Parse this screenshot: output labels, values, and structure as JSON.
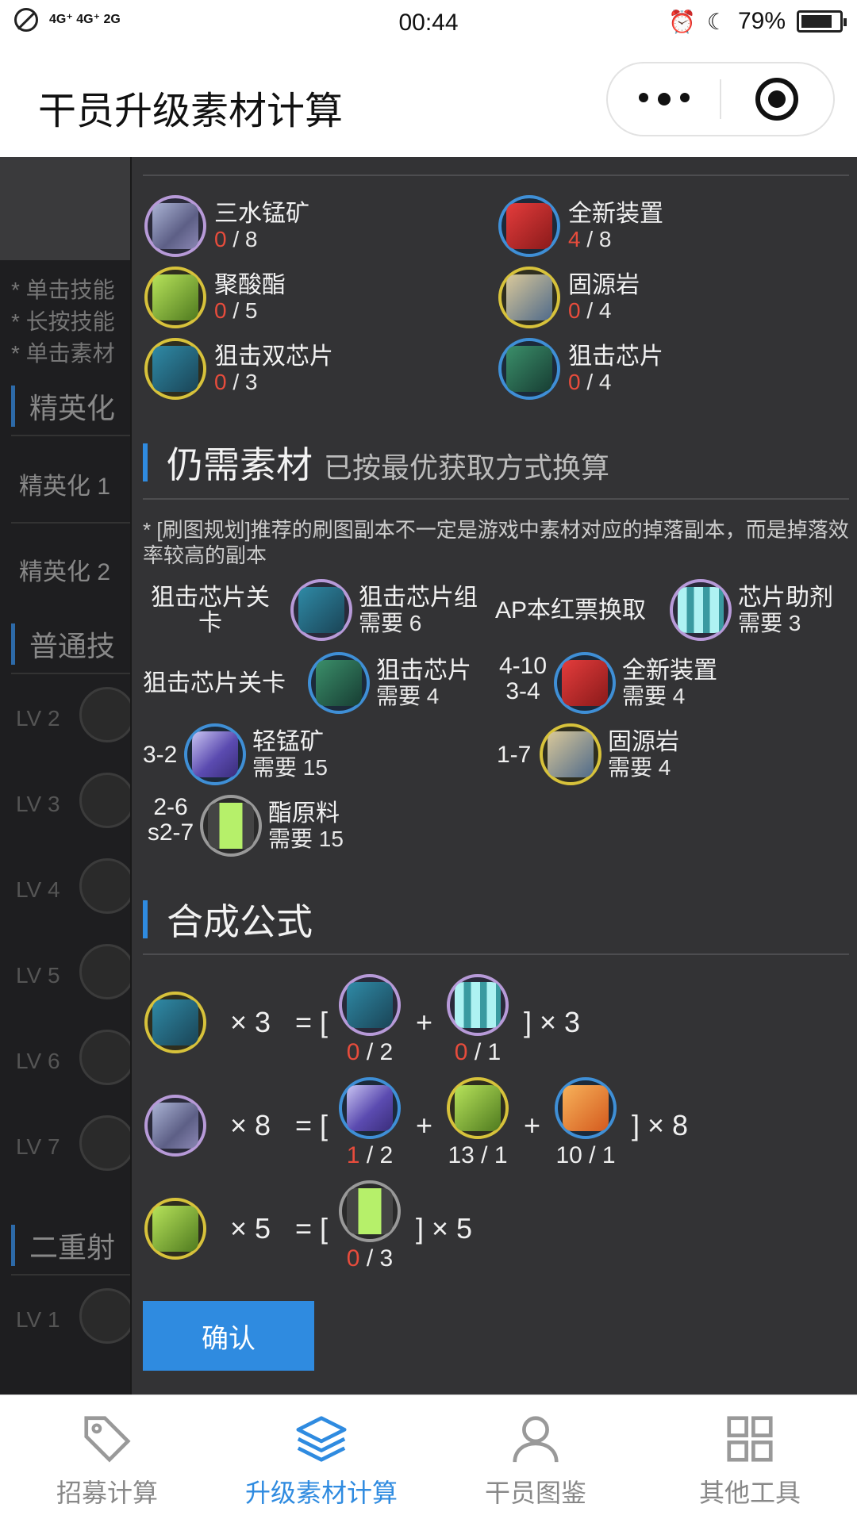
{
  "status": {
    "network": "4G⁺ 4G⁺ 2G",
    "time": "00:44",
    "battery": "79%"
  },
  "titlebar": {
    "title": "干员升级素材计算"
  },
  "background": {
    "tips": [
      "* 单击技能",
      "* 长按技能",
      "* 单击素材"
    ],
    "elite_heading": "精英化",
    "elite_items": [
      "精英化 1",
      "精英化 2"
    ],
    "skill_heading": "普通技",
    "skill_levels": [
      "LV 2",
      "LV 3",
      "LV 4",
      "LV 5",
      "LV 6",
      "LV 7"
    ],
    "second_heading": "二重射",
    "second_levels": [
      "LV 1"
    ]
  },
  "owned": [
    {
      "name": "三水锰矿",
      "have": "0",
      "need": " / 8",
      "icon": "sanshui-mengkuang-icon"
    },
    {
      "name": "全新装置",
      "have": "4",
      "need": " / 8",
      "icon": "quanxin-zhuangzhi-icon"
    },
    {
      "name": "聚酸酯",
      "have": "0",
      "need": " / 5",
      "icon": "jusuanzhi-icon"
    },
    {
      "name": "固源岩",
      "have": "0",
      "need": " / 4",
      "icon": "guyuanyan-icon"
    },
    {
      "name": "狙击双芯片",
      "have": "0",
      "need": " / 3",
      "icon": "sniper-dual-chip-icon"
    },
    {
      "name": "狙击芯片",
      "have": "0",
      "need": " / 4",
      "icon": "sniper-chip-icon"
    }
  ],
  "needed": {
    "heading": "仍需素材",
    "subheading": "已按最优获取方式换算",
    "note": "* [刷图规划]推荐的刷图副本不一定是游戏中素材对应的掉落副本，而是掉落效率较高的副本",
    "rows": [
      {
        "stage": "狙击芯片关\n卡",
        "name": "狙击芯片组",
        "need": "需要 6",
        "icon": "sniper-chip-pack-icon"
      },
      {
        "stage": "AP本红票换取",
        "name": "芯片助剂",
        "need": "需要 3",
        "icon": "chip-catalyst-icon"
      },
      {
        "stage": "狙击芯片关卡",
        "name": "狙击芯片",
        "need": "需要 4",
        "icon": "sniper-chip-icon"
      },
      {
        "stage": "4-10\n3-4",
        "name": "全新装置",
        "need": "需要 4",
        "icon": "quanxin-zhuangzhi-icon"
      },
      {
        "stage": "3-2",
        "name": "轻锰矿",
        "need": "需要 15",
        "icon": "qingmengkuang-icon"
      },
      {
        "stage": "1-7",
        "name": "固源岩",
        "need": "需要 4",
        "icon": "guyuanyan-icon"
      },
      {
        "stage": "2-6\ns2-7",
        "name": "酯原料",
        "need": "需要 15",
        "icon": "zhiyuanliao-icon"
      }
    ]
  },
  "formulas": {
    "heading": "合成公式",
    "items": [
      {
        "times": "× 3",
        "eq": "= [",
        "close": "] × 3",
        "parts": [
          {
            "have": "0",
            "need": " / 2"
          },
          {
            "have": "0",
            "need": " / 1"
          }
        ]
      },
      {
        "times": "× 8",
        "eq": "= [",
        "close": "] × 8",
        "parts": [
          {
            "have": "1",
            "need": " / 2"
          },
          {
            "have": "13",
            "need": " / 1"
          },
          {
            "have": "10",
            "need": " / 1"
          }
        ]
      },
      {
        "times": "× 5",
        "eq": "= [",
        "close": "] × 5",
        "parts": [
          {
            "have": "0",
            "need": " / 3"
          }
        ]
      }
    ],
    "plus": "+"
  },
  "confirm_label": "确认",
  "nav": {
    "tabs": [
      {
        "label": "招募计算"
      },
      {
        "label": "升级素材计算"
      },
      {
        "label": "干员图鉴"
      },
      {
        "label": "其他工具"
      }
    ],
    "accent": "#2f8be0"
  }
}
